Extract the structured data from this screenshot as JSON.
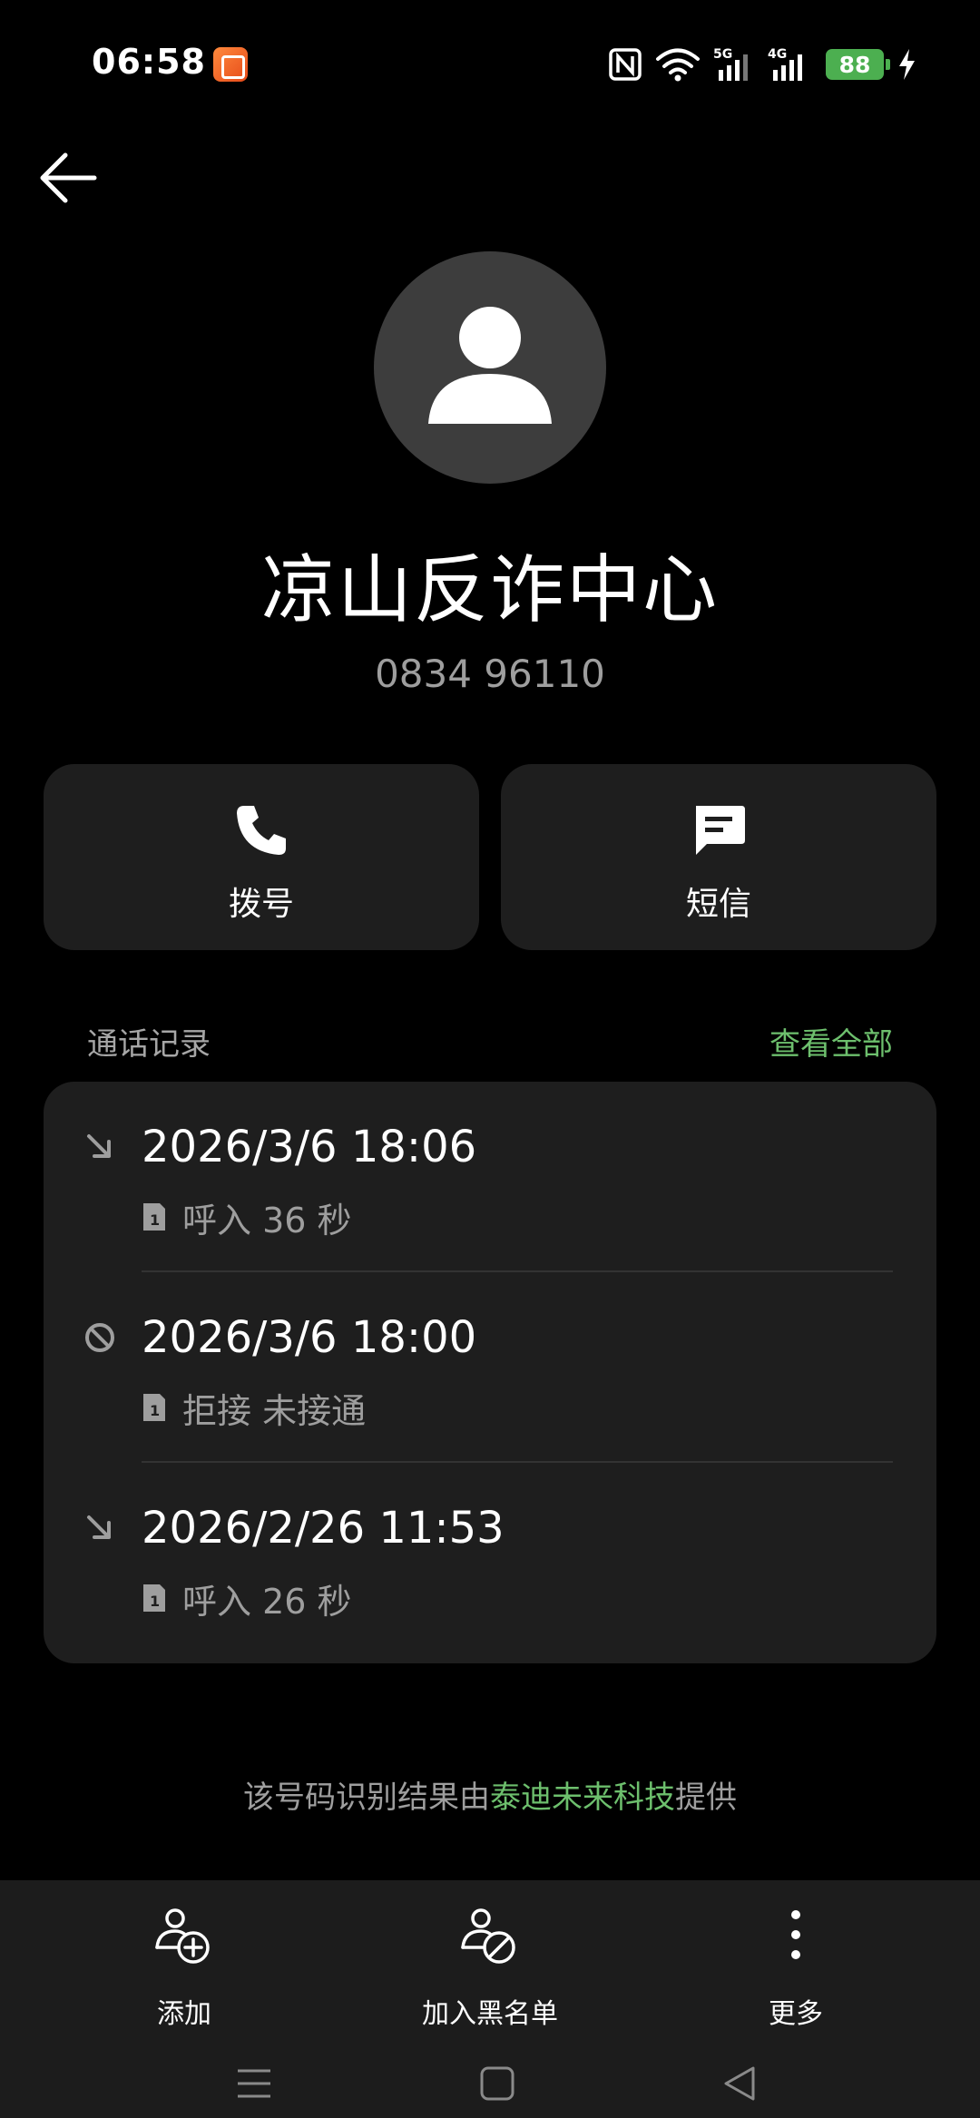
{
  "status_bar": {
    "time": "06:58",
    "signal_1_label": "5G",
    "signal_2_label": "4G",
    "battery": "88",
    "icons": [
      "app-notification-icon",
      "nfc-icon",
      "wifi-icon",
      "signal-5g-icon",
      "signal-4g-icon",
      "battery-icon",
      "charging-icon"
    ]
  },
  "contact": {
    "name": "凉山反诈中心",
    "number": "0834 96110"
  },
  "actions": {
    "dial_label": "拨号",
    "sms_label": "短信"
  },
  "call_log": {
    "title": "通话记录",
    "view_all": "查看全部",
    "entries": [
      {
        "time": "2026/3/6 18:06",
        "detail": "呼入  36 秒",
        "type": "incoming"
      },
      {
        "time": "2026/3/6 18:00",
        "detail": "拒接 未接通",
        "type": "rejected"
      },
      {
        "time": "2026/2/26 11:53",
        "detail": "呼入  26 秒",
        "type": "incoming"
      }
    ]
  },
  "attribution": {
    "prefix": "该号码识别结果由",
    "brand": "泰迪未来科技",
    "suffix": "提供"
  },
  "toolbar": {
    "add_label": "添加",
    "block_label": "加入黑名单",
    "more_label": "更多"
  },
  "colors": {
    "accent_green": "#6dbf6d",
    "card_bg": "#1e1e1e",
    "avatar_bg": "#3d3d3d",
    "battery_green": "#4caf50"
  }
}
